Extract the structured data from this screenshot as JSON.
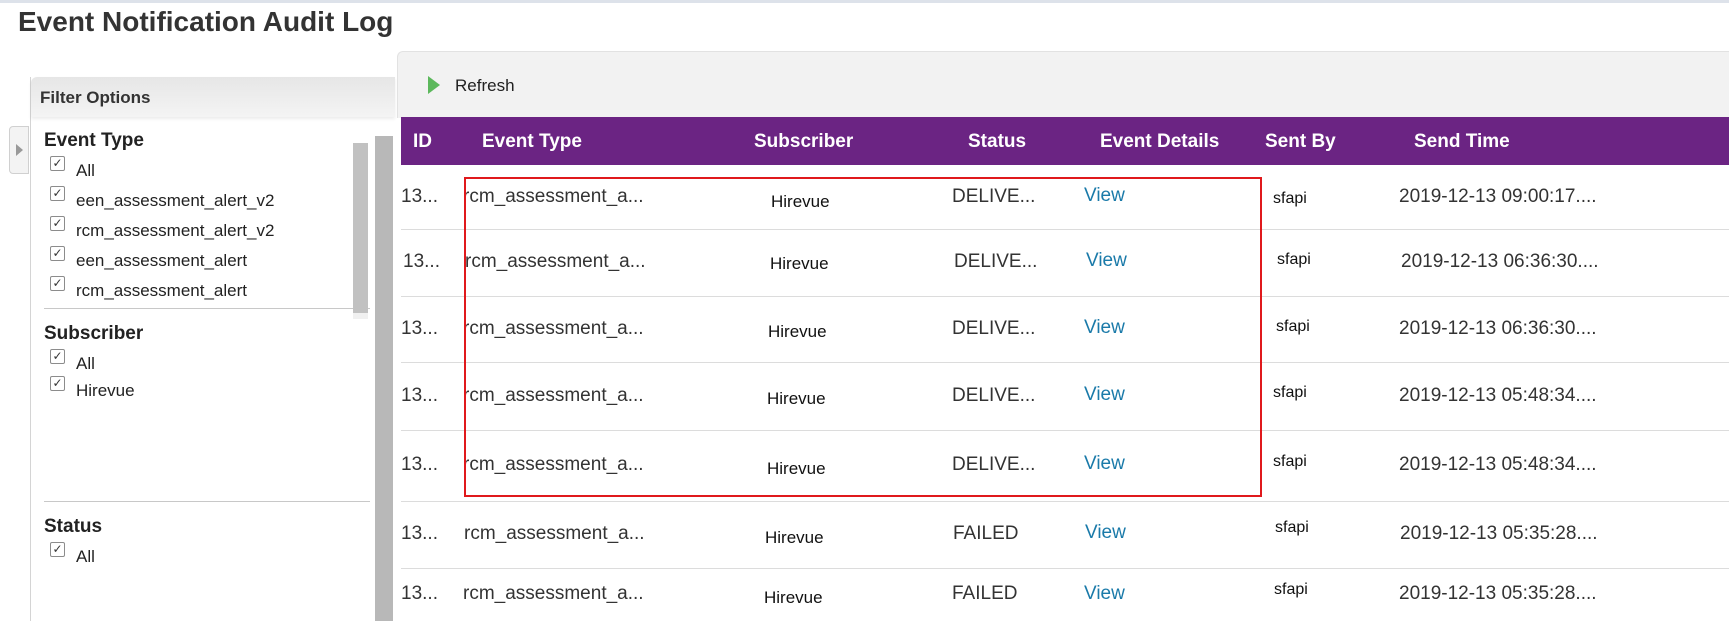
{
  "page": {
    "title": "Event Notification Audit Log"
  },
  "filter": {
    "header": "Filter Options",
    "groups": [
      {
        "title": "Event Type",
        "options": [
          {
            "label": "All",
            "checked": true
          },
          {
            "label": "een_assessment_alert_v2",
            "checked": true
          },
          {
            "label": "rcm_assessment_alert_v2",
            "checked": true
          },
          {
            "label": "een_assessment_alert",
            "checked": true
          },
          {
            "label": "rcm_assessment_alert",
            "checked": true
          }
        ]
      },
      {
        "title": "Subscriber",
        "options": [
          {
            "label": "All",
            "checked": true
          },
          {
            "label": "Hirevue",
            "checked": true
          }
        ]
      },
      {
        "title": "Status",
        "options": [
          {
            "label": "All",
            "checked": true
          }
        ]
      }
    ]
  },
  "toolbar": {
    "refresh_label": "Refresh"
  },
  "table": {
    "columns": [
      "ID",
      "Event Type",
      "Subscriber",
      "Status",
      "Event Details",
      "Sent By",
      "Send Time"
    ],
    "rows": [
      {
        "id": "13...",
        "event_type": "rcm_assessment_a...",
        "subscriber": "Hirevue",
        "status": "DELIVE...",
        "details": "View",
        "sent_by": "sfapi",
        "send_time": "2019-12-13 09:00:17...."
      },
      {
        "id": "13...",
        "event_type": "rcm_assessment_a...",
        "subscriber": "Hirevue",
        "status": "DELIVE...",
        "details": "View",
        "sent_by": "sfapi",
        "send_time": "2019-12-13 06:36:30...."
      },
      {
        "id": "13...",
        "event_type": "rcm_assessment_a...",
        "subscriber": "Hirevue",
        "status": "DELIVE...",
        "details": "View",
        "sent_by": "sfapi",
        "send_time": "2019-12-13 06:36:30...."
      },
      {
        "id": "13...",
        "event_type": "rcm_assessment_a...",
        "subscriber": "Hirevue",
        "status": "DELIVE...",
        "details": "View",
        "sent_by": "sfapi",
        "send_time": "2019-12-13 05:48:34...."
      },
      {
        "id": "13...",
        "event_type": "rcm_assessment_a...",
        "subscriber": "Hirevue",
        "status": "DELIVE...",
        "details": "View",
        "sent_by": "sfapi",
        "send_time": "2019-12-13 05:48:34...."
      },
      {
        "id": "13...",
        "event_type": "rcm_assessment_a...",
        "subscriber": "Hirevue",
        "status": "FAILED",
        "details": "View",
        "sent_by": "sfapi",
        "send_time": "2019-12-13 05:35:28...."
      },
      {
        "id": "13...",
        "event_type": "rcm_assessment_a...",
        "subscriber": "Hirevue",
        "status": "FAILED",
        "details": "View",
        "sent_by": "sfapi",
        "send_time": "2019-12-13 05:35:28...."
      }
    ]
  },
  "colors": {
    "header_bg": "#6b2483",
    "link": "#1a7aa9",
    "highlight": "#e0191c",
    "refresh_icon": "#5cb85c"
  },
  "icons": {
    "refresh": "play-triangle-icon",
    "checkbox": "checkmark-icon",
    "collapse": "chevron-right-icon"
  }
}
